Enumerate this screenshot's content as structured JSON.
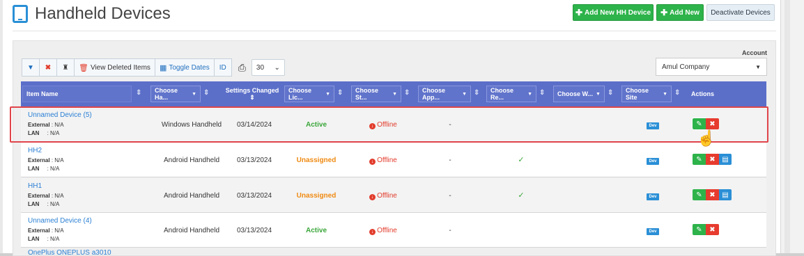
{
  "header": {
    "title": "Handheld Devices",
    "add_new_hh_label": "Add New HH Device",
    "add_new_label": "Add New",
    "deactivate_label": "Deactivate Devices"
  },
  "toolbar": {
    "view_deleted_label": "View Deleted Items",
    "toggle_dates_label": "Toggle Dates",
    "id_label": "ID",
    "page_size": "30"
  },
  "account": {
    "label": "Account",
    "value": "Amul Company"
  },
  "columns": {
    "item_name": "Item Name",
    "choose_handheld": "Choose Ha...",
    "settings_changed": "Settings Changed",
    "choose_license": "Choose Lic...",
    "choose_status": "Choose St...",
    "choose_app": "Choose App...",
    "choose_re": "Choose Re...",
    "choose_w": "Choose W...",
    "choose_site": "Choose Site",
    "actions": "Actions"
  },
  "labels": {
    "external": "External",
    "lan": "LAN",
    "na": ": N/A"
  },
  "rows": [
    {
      "name": "Unnamed Device (5)",
      "type": "Windows Handheld",
      "date": "03/14/2024",
      "license": "Active",
      "status": "Offline",
      "app": "-",
      "site": "Dev"
    },
    {
      "name": "HH2",
      "type": "Android Handheld",
      "date": "03/13/2024",
      "license": "Unassigned",
      "status": "Offline",
      "app": "-",
      "site": "Dev"
    },
    {
      "name": "HH1",
      "type": "Android Handheld",
      "date": "03/13/2024",
      "license": "Unassigned",
      "status": "Offline",
      "app": "-",
      "site": "Dev"
    },
    {
      "name": "Unnamed Device (4)",
      "type": "Android Handheld",
      "date": "03/13/2024",
      "license": "Active",
      "status": "Offline",
      "app": "-",
      "site": "Dev"
    }
  ],
  "partial_row_name": "OnePlus ONEPLUS a3010"
}
